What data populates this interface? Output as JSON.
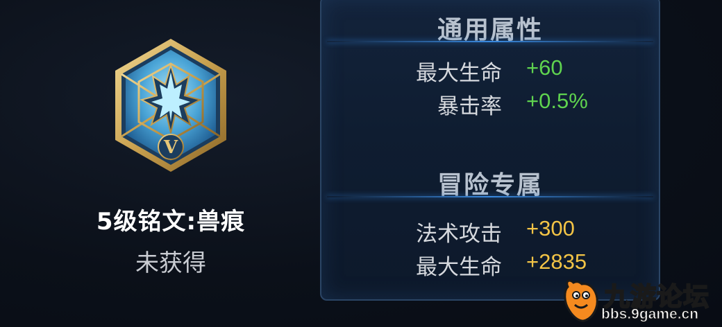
{
  "rune": {
    "name": "5级铭文:兽痕",
    "status": "未获得",
    "emblem_numeral": "V",
    "emblem_icon": "claw-mark-rune-icon",
    "colors": {
      "frame": "#c9a14f",
      "gem": "#4aa4d6"
    }
  },
  "panel": {
    "general": {
      "title": "通用属性",
      "stats": [
        {
          "label": "最大生命",
          "value": "+60"
        },
        {
          "label": "暴击率",
          "value": "+0.5%"
        }
      ],
      "value_color": "#5fd34f"
    },
    "adventure": {
      "title": "冒险专属",
      "stats": [
        {
          "label": "法术攻击",
          "value": "+300"
        },
        {
          "label": "最大生命",
          "value": "+2835"
        }
      ],
      "value_color": "#f3c446"
    }
  },
  "watermark": {
    "title": "九游论坛",
    "url": "bbs.9game.cn",
    "icon": "mascot-logo-icon"
  }
}
